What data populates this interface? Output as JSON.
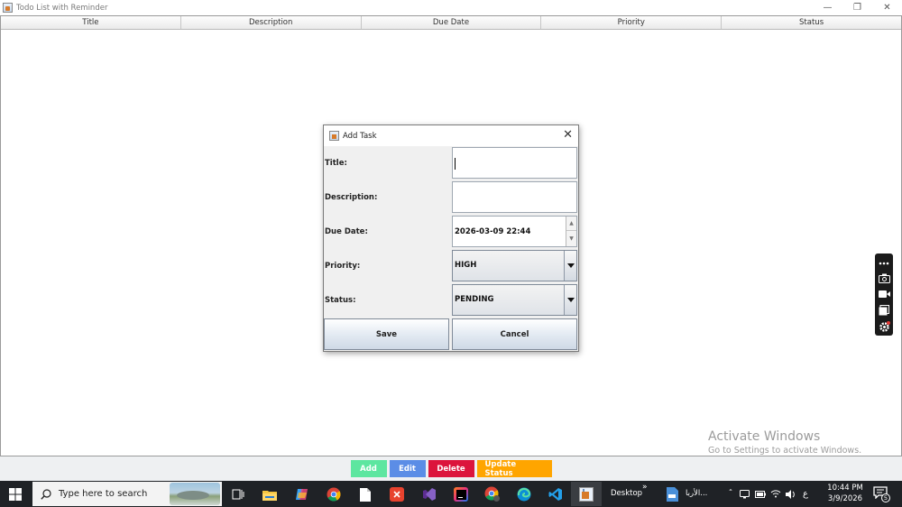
{
  "window": {
    "title": "Todo List with Reminder"
  },
  "table": {
    "columns": [
      "Title",
      "Description",
      "Due Date",
      "Priority",
      "Status"
    ]
  },
  "actions": [
    {
      "label": "Add",
      "color": "#5de6a0"
    },
    {
      "label": "Edit",
      "color": "#5b8de6"
    },
    {
      "label": "Delete",
      "color": "#dc143c"
    },
    {
      "label": "Update Status",
      "color": "#ffa500"
    }
  ],
  "dialog": {
    "title": "Add Task",
    "fields": {
      "title_label": "Title:",
      "description_label": "Description:",
      "due_date_label": "Due Date:",
      "due_date_value": "2026-03-09 22:44",
      "priority_label": "Priority:",
      "priority_value": "HIGH",
      "status_label": "Status:",
      "status_value": "PENDING"
    },
    "save_label": "Save",
    "cancel_label": "Cancel"
  },
  "watermark": {
    "line1": "Activate Windows",
    "line2": "Go to Settings to activate Windows."
  },
  "taskbar": {
    "search_placeholder": "Type here to search",
    "desktop_label": "Desktop",
    "app_label": "الأربا...",
    "input_lang": "ع",
    "time": "10:44 PM",
    "date": "3/9/2026",
    "notification_count": "5"
  }
}
